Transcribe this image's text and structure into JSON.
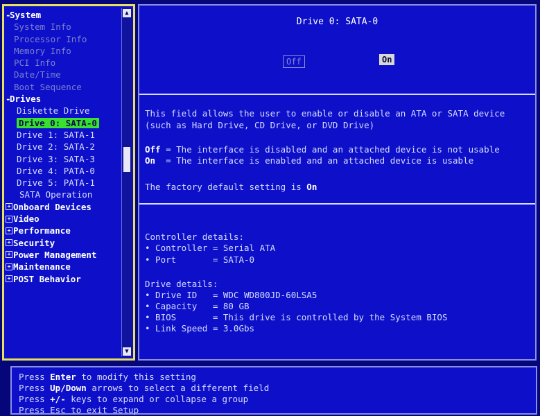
{
  "tree": {
    "system": "System",
    "system_items": [
      "System Info",
      "Processor Info",
      "Memory Info",
      "PCI Info",
      "Date/Time",
      "Boot Sequence"
    ],
    "drives": "Drives",
    "drive_items": [
      "Diskette Drive",
      "Drive 0: SATA-0",
      "Drive 1: SATA-1",
      "Drive 2: SATA-2",
      "Drive 3: SATA-3",
      "Drive 4: PATA-0",
      "Drive 5: PATA-1",
      "SATA Operation"
    ],
    "groups": [
      "Onboard Devices",
      "Video",
      "Performance",
      "Security",
      "Power Management",
      "Maintenance",
      "POST Behavior"
    ]
  },
  "scrollbar": {
    "up": "▲",
    "down": "▼"
  },
  "details": {
    "title": "Drive 0: SATA-0",
    "toggle_off": "Off",
    "toggle_on": "On",
    "description_1": "This field allows the user to enable or disable an ATA or SATA device",
    "description_2": "(such as Hard Drive, CD Drive, or DVD Drive)",
    "off_key": "Off",
    "off_text": " = The interface is disabled and an attached device is not usable",
    "on_key": "On",
    "on_text": "  = The interface is enabled and an attached device is usable",
    "default_prefix": "The factory default setting is ",
    "default_value": "On",
    "controller_header": "Controller details:",
    "controller_line": "• Controller = Serial ATA",
    "port_line": "• Port       = SATA-0",
    "drive_header": "Drive details:",
    "drive_id_line": "• Drive ID   = WDC WD800JD-60LSA5",
    "capacity_line": "• Capacity   = 80 GB",
    "bios_line": "• BIOS       = This drive is controlled by the System BIOS",
    "link_line": "• Link Speed = 3.0Gbs"
  },
  "help": {
    "line1_a": "Press ",
    "line1_key": "Enter",
    "line1_b": " to modify this setting",
    "line2_a": "Press ",
    "line2_key": "Up/Down",
    "line2_b": " arrows to select a different field",
    "line3_a": "Press ",
    "line3_key": "+/-",
    "line3_b": " keys to expand or collapse a group",
    "line4": "Press Esc to exit Setup"
  }
}
